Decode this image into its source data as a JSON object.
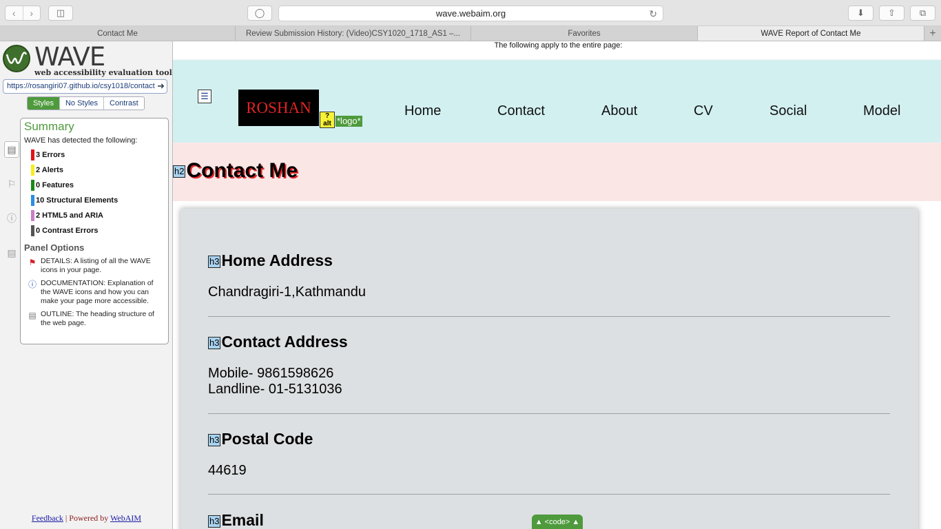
{
  "browser": {
    "url": "wave.webaim.org",
    "tabs": [
      {
        "label": "Contact Me",
        "active": false
      },
      {
        "label": "Review Submission History: (Video)CSY1020_1718_AS1 –...",
        "active": false
      },
      {
        "label": "Favorites",
        "active": false
      },
      {
        "label": "WAVE Report of Contact Me",
        "active": true
      }
    ],
    "new_tab": "+"
  },
  "wave": {
    "logo_word": "WAVE",
    "tagline": "web accessibility evaluation tool",
    "url_value": "https://rosangiri07.github.io/csy1018/contact",
    "style_tabs": [
      "Styles",
      "No Styles",
      "Contrast"
    ],
    "summary_title": "Summary",
    "summary_intro": "WAVE has detected the following:",
    "stats": [
      {
        "label": "3 Errors",
        "color": "#e0141b"
      },
      {
        "label": "2 Alerts",
        "color": "#f5ee1c"
      },
      {
        "label": "0 Features",
        "color": "#1a8a1a"
      },
      {
        "label": "10 Structural Elements",
        "color": "#2b8fe0"
      },
      {
        "label": "2 HTML5 and ARIA",
        "color": "#c77ec8"
      },
      {
        "label": "0 Contrast Errors",
        "color": "#555555"
      }
    ],
    "panel_options_title": "Panel Options",
    "options": [
      {
        "icon": "details-icon",
        "text": "DETAILS: A listing of all the WAVE icons in your page."
      },
      {
        "icon": "info-icon",
        "text": "DOCUMENTATION: Explanation of the WAVE icons and how you can make your page more accessible."
      },
      {
        "icon": "outline-icon",
        "text": "OUTLINE: The heading structure of the web page."
      }
    ],
    "footer_feedback": "Feedback",
    "footer_sep": " | Powered by ",
    "footer_webaim": "WebAIM"
  },
  "page": {
    "notice": "The following apply to the entire page:",
    "brand": "ROSHAN",
    "alt_icon": "alt",
    "alt_text": "*logo*",
    "nav": [
      "Home",
      "Contact",
      "About",
      "CV",
      "Social",
      "Model"
    ],
    "h2_tag": "h2",
    "title": "Contact Me",
    "h3_tag": "h3",
    "sections": [
      {
        "heading": "Home Address",
        "lines": [
          "Chandragiri-1,Kathmandu"
        ]
      },
      {
        "heading": "Contact Address",
        "lines": [
          "Mobile- 9861598626",
          "Landline- 01-5131036"
        ]
      },
      {
        "heading": "Postal Code",
        "lines": [
          "44619"
        ]
      },
      {
        "heading": "Email",
        "lines": []
      }
    ],
    "code_toggle": "▲ <code> ▲"
  }
}
